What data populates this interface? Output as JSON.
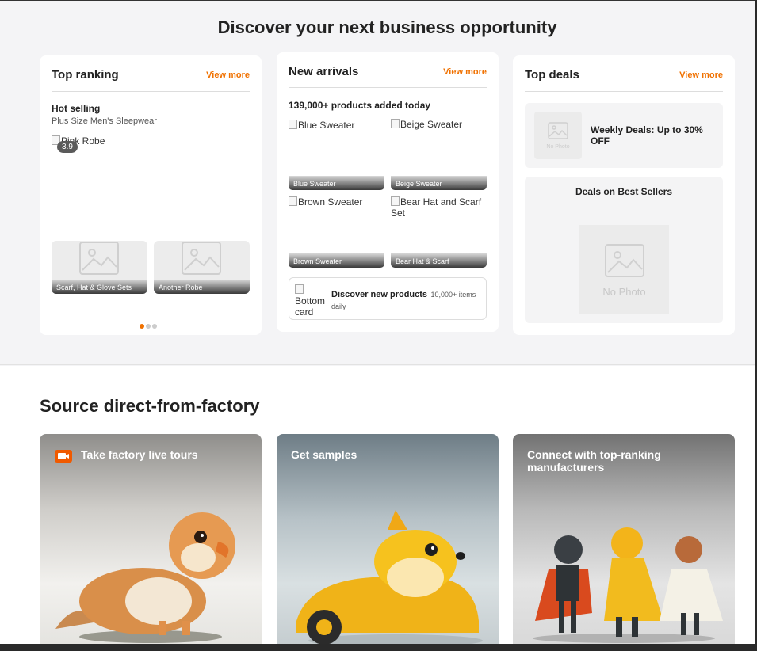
{
  "discover": {
    "title": "Discover your next business opportunity"
  },
  "top_ranking": {
    "title": "Top ranking",
    "view_more": "View more",
    "subtitle": "Hot selling",
    "category": "Plus Size Men's Sleepwear",
    "main_image_alt": "Pink Robe",
    "rating": "3.9",
    "thumbs": [
      {
        "label": "Scarf, Hat & Glove Sets"
      },
      {
        "label": "Another Robe"
      }
    ],
    "pager_total": 3,
    "pager_active": 1
  },
  "new_arrivals": {
    "title": "New arrivals",
    "view_more": "View more",
    "count_text": "139,000+ products added today",
    "items": [
      {
        "alt": "Blue Sweater",
        "caption": "Blue Sweater"
      },
      {
        "alt": "Beige Sweater",
        "caption": "Beige Sweater"
      },
      {
        "alt": "Brown Sweater",
        "caption": "Brown Sweater"
      },
      {
        "alt": "Bear Hat and Scarf Set",
        "caption": "Bear Hat & Scarf"
      }
    ],
    "bottom_card": {
      "image_alt": "Bottom card",
      "title": "Discover new products",
      "subtitle": "10,000+ items daily"
    }
  },
  "top_deals": {
    "title": "Top deals",
    "view_more": "View more",
    "weekly": {
      "image_text": "No Photo",
      "text": "Weekly Deals: Up to 30% OFF"
    },
    "best_sellers": {
      "title": "Deals on Best Sellers",
      "image_text": "No Photo"
    }
  },
  "factory": {
    "title": "Source direct-from-factory",
    "cards": [
      {
        "label": "Take factory live tours",
        "icon": "video-camera-icon"
      },
      {
        "label": "Get samples"
      },
      {
        "label": "Connect with top-ranking manufacturers"
      }
    ]
  },
  "colors": {
    "accent": "#f07100",
    "camera_icon": "#f05a00"
  }
}
